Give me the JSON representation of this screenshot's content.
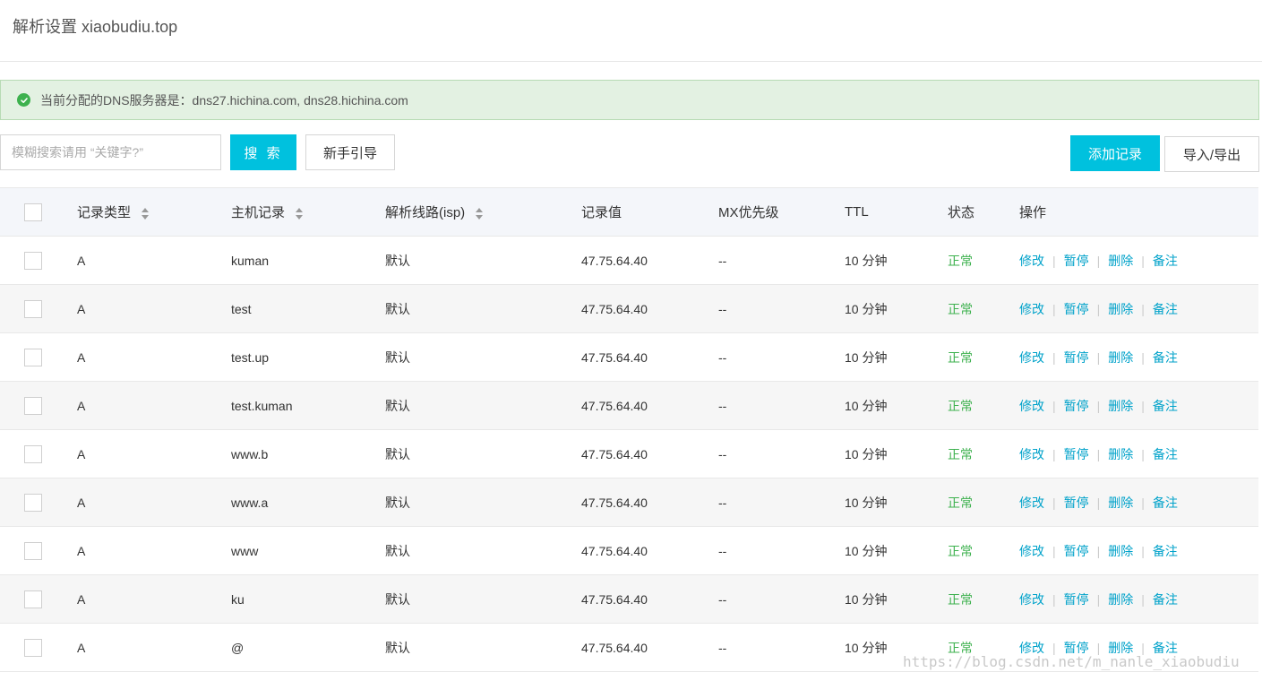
{
  "page": {
    "title": "解析设置 xiaobudiu.top"
  },
  "alert": {
    "text": "当前分配的DNS服务器是：dns27.hichina.com, dns28.hichina.com",
    "icon": "check-circle-icon",
    "color": "#3db14e"
  },
  "toolbar": {
    "search_placeholder": "模糊搜索请用 “关键字?”",
    "search_label": "搜 索",
    "guide_label": "新手引导",
    "add_label": "添加记录",
    "import_export_label": "导入/导出"
  },
  "table": {
    "headers": {
      "type": "记录类型",
      "host": "主机记录",
      "line": "解析线路(isp)",
      "value": "记录值",
      "mx": "MX优先级",
      "ttl": "TTL",
      "status": "状态",
      "ops": "操作"
    },
    "ops_labels": {
      "edit": "修改",
      "pause": "暂停",
      "delete": "删除",
      "note": "备注",
      "separator": "|"
    },
    "rows": [
      {
        "type": "A",
        "host": "kuman",
        "line": "默认",
        "value": "47.75.64.40",
        "mx": "--",
        "ttl": "10 分钟",
        "status": "正常"
      },
      {
        "type": "A",
        "host": "test",
        "line": "默认",
        "value": "47.75.64.40",
        "mx": "--",
        "ttl": "10 分钟",
        "status": "正常"
      },
      {
        "type": "A",
        "host": "test.up",
        "line": "默认",
        "value": "47.75.64.40",
        "mx": "--",
        "ttl": "10 分钟",
        "status": "正常"
      },
      {
        "type": "A",
        "host": "test.kuman",
        "line": "默认",
        "value": "47.75.64.40",
        "mx": "--",
        "ttl": "10 分钟",
        "status": "正常"
      },
      {
        "type": "A",
        "host": "www.b",
        "line": "默认",
        "value": "47.75.64.40",
        "mx": "--",
        "ttl": "10 分钟",
        "status": "正常"
      },
      {
        "type": "A",
        "host": "www.a",
        "line": "默认",
        "value": "47.75.64.40",
        "mx": "--",
        "ttl": "10 分钟",
        "status": "正常"
      },
      {
        "type": "A",
        "host": "www",
        "line": "默认",
        "value": "47.75.64.40",
        "mx": "--",
        "ttl": "10 分钟",
        "status": "正常"
      },
      {
        "type": "A",
        "host": "ku",
        "line": "默认",
        "value": "47.75.64.40",
        "mx": "--",
        "ttl": "10 分钟",
        "status": "正常"
      },
      {
        "type": "A",
        "host": "@",
        "line": "默认",
        "value": "47.75.64.40",
        "mx": "--",
        "ttl": "10 分钟",
        "status": "正常"
      }
    ]
  },
  "watermark": {
    "text": "https://blog.csdn.net/m_nanle_xiaobudiu"
  },
  "colors": {
    "primary": "#00c1de",
    "link": "#00a2ca",
    "status_ok": "#3db14e",
    "alert_bg": "#e3f1e2"
  }
}
